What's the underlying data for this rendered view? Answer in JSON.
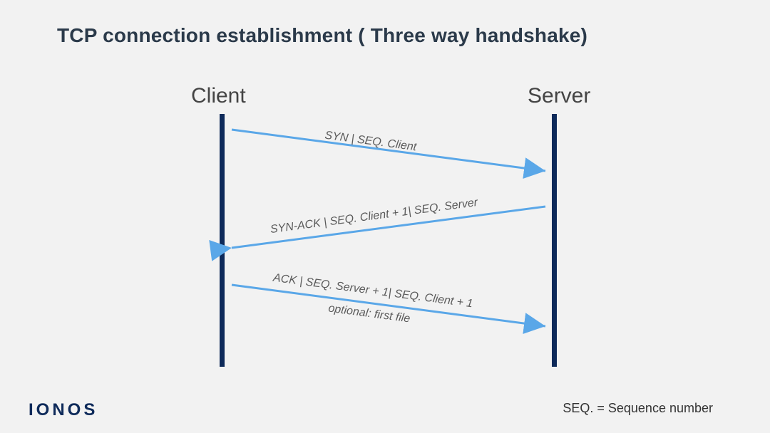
{
  "title": "TCP connection establishment ( Three way handshake)",
  "actors": {
    "client": "Client",
    "server": "Server"
  },
  "messages": {
    "m1": {
      "label": "SYN | SEQ. Client",
      "sublabel": ""
    },
    "m2": {
      "label": "SYN-ACK | SEQ. Client + 1| SEQ. Server",
      "sublabel": ""
    },
    "m3": {
      "label": "ACK | SEQ. Server + 1| SEQ. Client + 1",
      "sublabel": "optional: first file"
    }
  },
  "legend": "SEQ. = Sequence number",
  "logo": "IONOS",
  "colors": {
    "lifeline": "#0e2a5a",
    "arrow": "#5aa7e8",
    "text": "#5a5a5a"
  }
}
